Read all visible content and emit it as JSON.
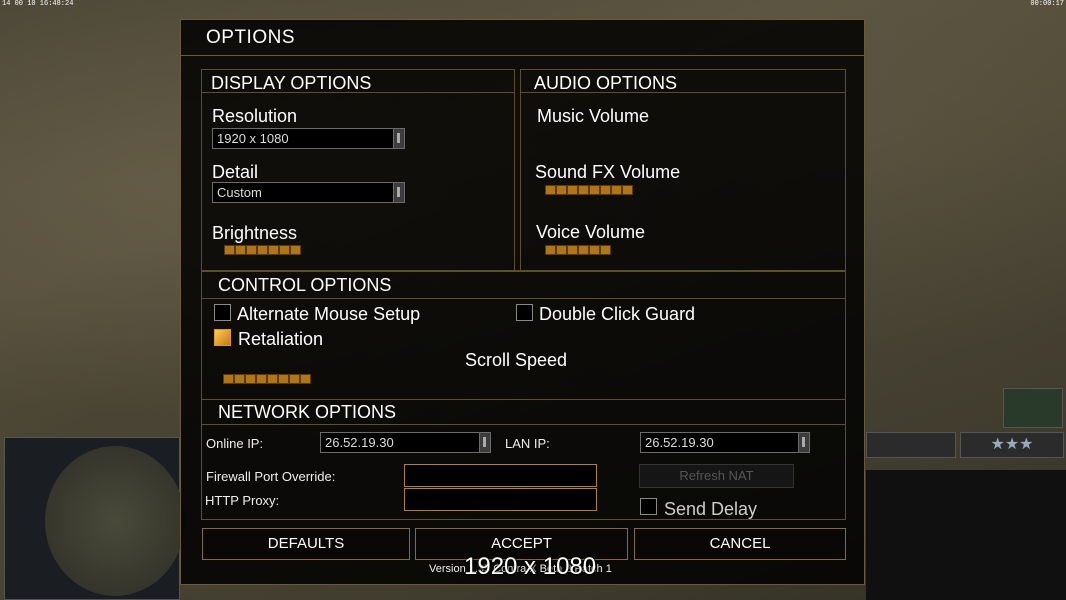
{
  "top_bar": {
    "left_stats": "14 00 10 16:48:24",
    "right_time": "00:00:17"
  },
  "dialog": {
    "title": "OPTIONS"
  },
  "display": {
    "title": "DISPLAY OPTIONS",
    "resolution_label": "Resolution",
    "resolution_value": "1920 x 1080",
    "detail_label": "Detail",
    "detail_value": "Custom",
    "brightness_label": "Brightness",
    "brightness_level": 7
  },
  "audio": {
    "title": "AUDIO OPTIONS",
    "music_label": "Music Volume",
    "music_level": 0,
    "sfx_label": "Sound FX Volume",
    "sfx_level": 8,
    "voice_label": "Voice Volume",
    "voice_level": 6
  },
  "control": {
    "title": "CONTROL OPTIONS",
    "alt_mouse_label": "Alternate Mouse Setup",
    "alt_mouse_checked": false,
    "double_click_label": "Double Click Guard",
    "double_click_checked": false,
    "retaliation_label": "Retaliation",
    "retaliation_checked": true,
    "scroll_label": "Scroll Speed",
    "scroll_level": 8
  },
  "network": {
    "title": "NETWORK OPTIONS",
    "online_ip_label": "Online IP:",
    "online_ip_value": "26.52.19.30",
    "lan_ip_label": "LAN IP:",
    "lan_ip_value": "26.52.19.30",
    "firewall_label": "Firewall Port Override:",
    "firewall_value": "",
    "proxy_label": "HTTP Proxy:",
    "proxy_value": "",
    "refresh_nat_label": "Refresh NAT",
    "send_delay_label": "Send Delay",
    "send_delay_checked": false
  },
  "buttons": {
    "defaults": "DEFAULTS",
    "accept": "ACCEPT",
    "cancel": "CANCEL"
  },
  "version_text": "Version 1.35 Contra X Beta 2 Patch 1",
  "resolution_overlay": "1920 x 1080",
  "colors": {
    "accent": "#b07518",
    "border": "#6a5a38",
    "background": "#000000"
  }
}
